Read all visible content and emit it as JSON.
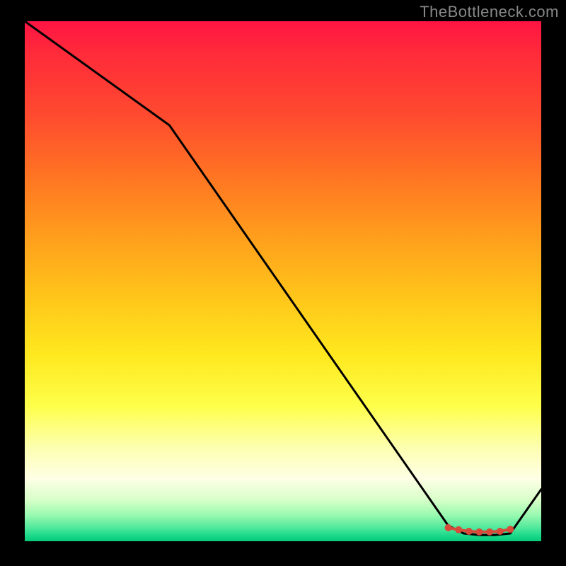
{
  "watermark": "TheBottleneck.com",
  "chart_data": {
    "type": "line",
    "title": "",
    "xlabel": "",
    "ylabel": "",
    "xlim": [
      0,
      100
    ],
    "ylim": [
      0,
      100
    ],
    "series": [
      {
        "name": "curve",
        "x": [
          0,
          28,
          82,
          85,
          88,
          91,
          94,
          100
        ],
        "y": [
          100,
          80,
          3,
          1.5,
          1.2,
          1.2,
          1.5,
          10
        ]
      }
    ],
    "markers": {
      "name": "highlight-range",
      "x": [
        82,
        84,
        86,
        88,
        90,
        92,
        94
      ],
      "y": [
        2.6,
        2.2,
        1.9,
        1.8,
        1.8,
        1.9,
        2.3
      ],
      "color": "#d84a3a"
    },
    "background_gradient": {
      "top": "#ff1444",
      "mid": "#ffe81e",
      "bottom": "#05c97a"
    }
  }
}
